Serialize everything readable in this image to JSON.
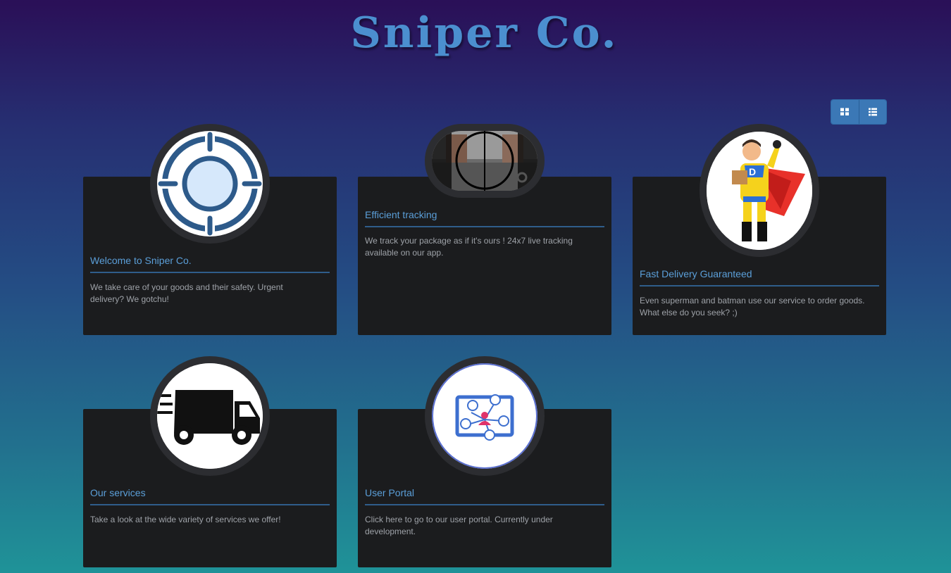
{
  "site": {
    "title": "Sniper Co."
  },
  "view_toggle": {
    "grid_icon": "grid-icon",
    "list_icon": "list-icon"
  },
  "cards": [
    {
      "title": "Welcome to Sniper Co.",
      "text": "We take care of your goods and their safety. Urgent delivery? We gotchu!",
      "icon": "target-icon"
    },
    {
      "title": "Efficient tracking",
      "text": "We track your package as if it's ours ! 24x7 live tracking available on our app.",
      "icon": "scope-view-image"
    },
    {
      "title": "Fast Delivery Guaranteed",
      "text": "Even superman and batman use our service to order goods. What else do you seek? ;)",
      "icon": "superhero-courier-image"
    },
    {
      "title": "Our services",
      "text": "Take a look at the wide variety of services we offer!",
      "icon": "truck-icon"
    },
    {
      "title": "User Portal",
      "text": "Click here to go to our user portal. Currently under development.",
      "icon": "user-portal-icon"
    }
  ],
  "colors": {
    "accent": "#5b9fd9",
    "card_bg": "#1b1c1e",
    "button": "#3b78b6"
  }
}
